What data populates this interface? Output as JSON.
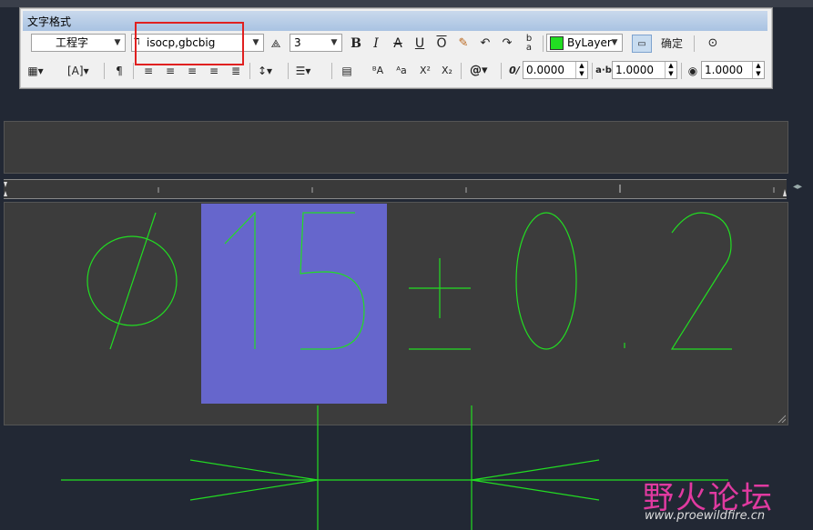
{
  "dialog": {
    "title": "文字格式",
    "style_combo": "工程字",
    "font_combo": "isocp,gbcbig",
    "height_combo": "3",
    "bold": "B",
    "italic": "I",
    "strike": "A",
    "underline": "U",
    "overline": "O",
    "color_combo": "ByLayer",
    "ok_label": "确定",
    "oblique_value": "0.0000",
    "tracking_value": "1.0000",
    "width_value": "1.0000",
    "tracking_label": "a·b",
    "oblique_label": "0/",
    "symbol_label": "@",
    "superscript": "X²",
    "subscript": "X₂"
  },
  "editor_text": "Ø15±0.2",
  "watermark": {
    "cn": "野火论坛",
    "url": "www.proewildfire.cn"
  },
  "colors": {
    "cad_green": "#22dd22",
    "selection": "#6666cc",
    "highlight": "#e02020",
    "watermark": "#e03aa0"
  }
}
